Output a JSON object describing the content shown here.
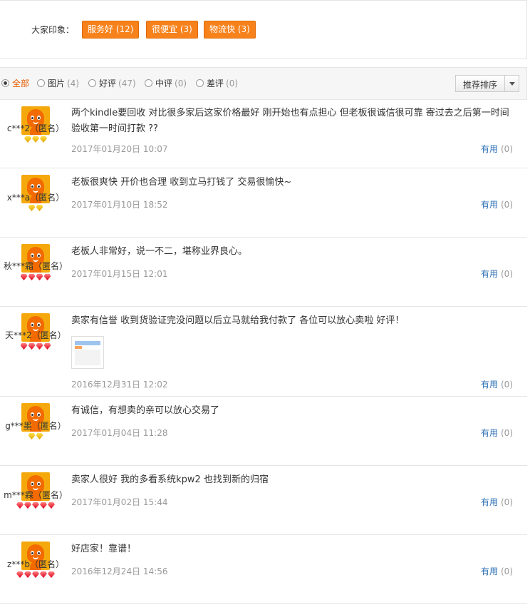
{
  "impressions": {
    "title": "大家印象：",
    "tags": [
      {
        "label": "服务好 (12)"
      },
      {
        "label": "很便宜 (3)"
      },
      {
        "label": "物流快 (3)"
      }
    ]
  },
  "filters": [
    {
      "label": "全部",
      "count": "",
      "selected": true
    },
    {
      "label": "图片",
      "count": "(4)",
      "selected": false
    },
    {
      "label": "好评",
      "count": "(47)",
      "selected": false
    },
    {
      "label": "中评",
      "count": "(0)",
      "selected": false
    },
    {
      "label": "差评",
      "count": "(0)",
      "selected": false
    }
  ],
  "sort": {
    "label": "推荐排序"
  },
  "useful_label": "有用",
  "reviews": [
    {
      "user": "c***2（匿名）",
      "badge_type": "gold",
      "badge_count": 3,
      "content": "两个kindle要回收 对比很多家后这家价格最好 刚开始也有点担心 但老板很诚信很可靠 寄过去之后第一时间验收第一时间打款 ??",
      "date": "2017年01月20日 10:07",
      "useful_count": "(0)",
      "has_image": false
    },
    {
      "user": "x***a（匿名）",
      "badge_type": "gold",
      "badge_count": 2,
      "content": "老板很爽快 开价也合理 收到立马打钱了 交易很愉快~",
      "date": "2017年01月10日 18:52",
      "useful_count": "(0)",
      "has_image": false
    },
    {
      "user": "秋***霜（匿名）",
      "badge_type": "red",
      "badge_count": 4,
      "content": "老板人非常好，说一不二，堪称业界良心。",
      "date": "2017年01月15日 12:01",
      "useful_count": "(0)",
      "has_image": false
    },
    {
      "user": "天***2（匿名）",
      "badge_type": "red",
      "badge_count": 4,
      "content": "卖家有信誉 收到货验证完没问题以后立马就给我付款了 各位可以放心卖啦 好评！",
      "date": "2016年12月31日 12:02",
      "useful_count": "(0)",
      "has_image": true
    },
    {
      "user": "g***墨（匿名）",
      "badge_type": "gold",
      "badge_count": 2,
      "content": "有诚信，有想卖的亲可以放心交易了",
      "date": "2017年01月04日 11:28",
      "useful_count": "(0)",
      "has_image": false
    },
    {
      "user": "m***霖（匿名）",
      "badge_type": "red",
      "badge_count": 5,
      "content": "卖家人很好 我的多看系统kpw2 也找到新的归宿",
      "date": "2017年01月02日 15:44",
      "useful_count": "(0)",
      "has_image": false
    },
    {
      "user": "z***b（匿名）",
      "badge_type": "red",
      "badge_count": 5,
      "content": "好店家！靠谱！",
      "date": "2016年12月24日 14:56",
      "useful_count": "(0)",
      "has_image": false
    }
  ]
}
